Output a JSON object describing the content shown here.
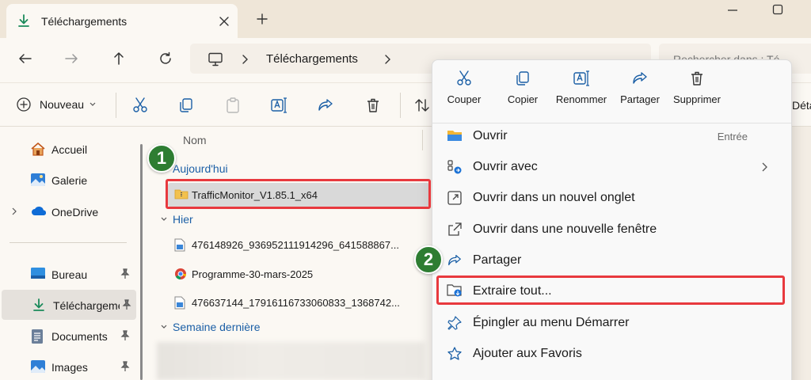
{
  "tab": {
    "title": "Téléchargements",
    "icon": "download-icon"
  },
  "address": {
    "segment": "Téléchargements"
  },
  "search": {
    "placeholder": "Rechercher dans : Té"
  },
  "toolbar": {
    "new_label": "Nouveau",
    "details_label": "Déta"
  },
  "sidebar": {
    "items": [
      {
        "label": "Accueil",
        "icon": "home-icon"
      },
      {
        "label": "Galerie",
        "icon": "gallery-icon"
      },
      {
        "label": "OneDrive",
        "icon": "onedrive-icon"
      },
      {
        "label": "Bureau",
        "icon": "desktop-icon"
      },
      {
        "label": "Téléchargements",
        "icon": "download-icon"
      },
      {
        "label": "Documents",
        "icon": "documents-icon"
      },
      {
        "label": "Images",
        "icon": "images-icon"
      }
    ]
  },
  "filelist": {
    "column_name": "Nom",
    "groups": [
      {
        "label": "Aujourd'hui"
      },
      {
        "label": "Hier"
      },
      {
        "label": "Semaine dernière"
      }
    ],
    "files": [
      {
        "name": "TrafficMonitor_V1.85.1_x64",
        "icon": "zip-folder-icon"
      },
      {
        "name": "476148926_936952111914296_641588867...",
        "icon": "image-file-icon"
      },
      {
        "name": "Programme-30-mars-2025",
        "icon": "chrome-icon"
      },
      {
        "name": "476637144_17916116733060833_1368742...",
        "icon": "image-file-icon"
      }
    ]
  },
  "context_menu": {
    "quick_actions": [
      {
        "label": "Couper",
        "icon": "cut-icon"
      },
      {
        "label": "Copier",
        "icon": "copy-icon"
      },
      {
        "label": "Renommer",
        "icon": "rename-icon"
      },
      {
        "label": "Partager",
        "icon": "share-icon"
      },
      {
        "label": "Supprimer",
        "icon": "delete-icon"
      }
    ],
    "items": [
      {
        "label": "Ouvrir",
        "shortcut": "Entrée",
        "icon": "folder-open-icon"
      },
      {
        "label": "Ouvrir avec",
        "icon": "open-with-icon"
      },
      {
        "label": "Ouvrir dans un nouvel onglet",
        "icon": "new-tab-icon"
      },
      {
        "label": "Ouvrir dans une nouvelle fenêtre",
        "icon": "new-window-icon"
      },
      {
        "label": "Partager",
        "icon": "share-icon"
      },
      {
        "label": "Extraire tout...",
        "icon": "extract-icon"
      },
      {
        "label": "Épingler au menu Démarrer",
        "icon": "pin-icon"
      },
      {
        "label": "Ajouter aux Favoris",
        "icon": "star-icon"
      }
    ]
  },
  "annotations": {
    "step1": "1",
    "step2": "2"
  },
  "colors": {
    "highlight": "#e8393e",
    "badge": "#2e7d32",
    "accent": "#1b8a5a"
  }
}
